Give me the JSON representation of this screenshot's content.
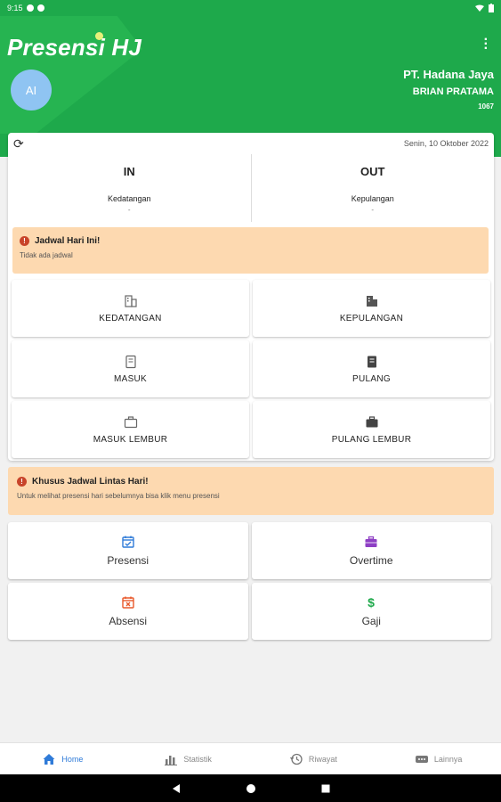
{
  "status_bar": {
    "time": "9:15"
  },
  "header": {
    "app_title": "Presensi HJ",
    "avatar_initials": "AI",
    "company": "PT. Hadana Jaya",
    "user_name": "BRIAN PRATAMA",
    "user_id": "1067"
  },
  "attendance": {
    "date": "Senin, 10 Oktober 2022",
    "in": {
      "title": "IN",
      "label": "Kedatangan",
      "value": "-"
    },
    "out": {
      "title": "OUT",
      "label": "Kepulangan",
      "value": "-"
    }
  },
  "schedule_alert": {
    "title": "Jadwal Hari Ini!",
    "body": "Tidak ada jadwal"
  },
  "actions": [
    {
      "label": "KEDATANGAN",
      "icon": "building-outline-icon"
    },
    {
      "label": "KEPULANGAN",
      "icon": "building-filled-icon"
    },
    {
      "label": "MASUK",
      "icon": "document-outline-icon"
    },
    {
      "label": "PULANG",
      "icon": "document-filled-icon"
    },
    {
      "label": "MASUK LEMBUR",
      "icon": "briefcase-outline-icon"
    },
    {
      "label": "PULANG LEMBUR",
      "icon": "briefcase-filled-icon"
    }
  ],
  "cross_day_alert": {
    "title": "Khusus Jadwal Lintas Hari!",
    "body": "Untuk melihat presensi hari sebelumnya bisa klik menu presensi"
  },
  "menu": [
    {
      "label": "Presensi",
      "icon": "calendar-check-icon",
      "color": "#2f7bd8"
    },
    {
      "label": "Overtime",
      "icon": "briefcase-icon",
      "color": "#8e3fc4"
    },
    {
      "label": "Absensi",
      "icon": "calendar-x-icon",
      "color": "#e8582a"
    },
    {
      "label": "Gaji",
      "icon": "dollar-icon",
      "color": "#1ea94b"
    }
  ],
  "bottom_nav": [
    {
      "label": "Home",
      "icon": "home-icon"
    },
    {
      "label": "Statistik",
      "icon": "bar-chart-icon"
    },
    {
      "label": "Riwayat",
      "icon": "history-icon"
    },
    {
      "label": "Lainnya",
      "icon": "more-icon"
    }
  ],
  "colors": {
    "primary": "#1ea94b",
    "alert_bg": "#fdd9b0",
    "active_nav": "#2f7bd8"
  }
}
